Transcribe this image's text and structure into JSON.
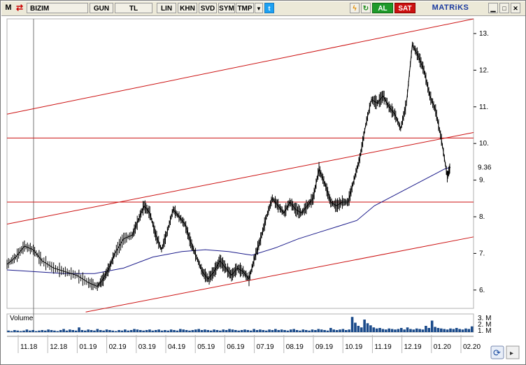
{
  "toolbar": {
    "m_label": "M",
    "symbol": "BIZIM",
    "period": "GUN",
    "currency": "TL",
    "scale": "LIN",
    "buttons": [
      "KHN",
      "SVD",
      "SYM",
      "TMP"
    ],
    "buy": "AL",
    "sell": "SAT",
    "logo": "MATRiKS",
    "colors": {
      "buy": "#1f9a2a",
      "sell": "#cc1111",
      "logo": "#1a3aa0"
    },
    "icons": [
      "app-icon",
      "symbol-arrow-icon",
      "dropdown-arrow-icon",
      "twitter-icon",
      "lightning-icon",
      "refresh-icon",
      "minimize-icon",
      "restore-icon",
      "close-icon",
      "sync-icon"
    ]
  },
  "volume_panel": {
    "title": "Volume",
    "y_ticks": [
      "3. M",
      "2. M",
      "1. M"
    ]
  },
  "chart_data": {
    "type": "line",
    "y_ticks": [
      "13.",
      "12.",
      "11.",
      "10.",
      "9.",
      "8.",
      "7.",
      "6."
    ],
    "y_tick_values": [
      13,
      12,
      11,
      10,
      9,
      8,
      7,
      6
    ],
    "last_price_label": "9.36",
    "x_ticks": [
      "11.18",
      "12.18",
      "01.19",
      "02.19",
      "03.19",
      "04.19",
      "05.19",
      "06.19",
      "07.19",
      "08.19",
      "09.19",
      "10.19",
      "11.19",
      "12.19",
      "01.20",
      "02.20"
    ],
    "ylim": [
      5.5,
      13.4
    ],
    "price_points": [
      [
        0,
        6.7
      ],
      [
        3,
        6.9
      ],
      [
        6,
        7.2
      ],
      [
        9,
        7.1
      ],
      [
        12,
        6.8
      ],
      [
        16,
        6.6
      ],
      [
        20,
        6.5
      ],
      [
        24,
        6.4
      ],
      [
        28,
        6.2
      ],
      [
        31,
        6.1
      ],
      [
        33,
        6.3
      ],
      [
        35,
        6.6
      ],
      [
        37,
        7.0
      ],
      [
        40,
        7.4
      ],
      [
        43,
        7.5
      ],
      [
        45,
        7.9
      ],
      [
        47,
        8.3
      ],
      [
        49,
        8.1
      ],
      [
        51,
        7.5
      ],
      [
        53,
        7.1
      ],
      [
        55,
        7.6
      ],
      [
        57,
        8.2
      ],
      [
        59,
        8.0
      ],
      [
        61,
        7.8
      ],
      [
        63,
        7.3
      ],
      [
        65,
        6.9
      ],
      [
        67,
        6.5
      ],
      [
        69,
        6.3
      ],
      [
        71,
        6.5
      ],
      [
        73,
        6.8
      ],
      [
        75,
        6.6
      ],
      [
        77,
        6.4
      ],
      [
        79,
        6.6
      ],
      [
        81,
        6.5
      ],
      [
        83,
        6.3
      ],
      [
        85,
        6.9
      ],
      [
        87,
        7.4
      ],
      [
        89,
        8.0
      ],
      [
        91,
        8.5
      ],
      [
        93,
        8.3
      ],
      [
        95,
        8.1
      ],
      [
        97,
        8.4
      ],
      [
        99,
        8.2
      ],
      [
        101,
        8.1
      ],
      [
        103,
        8.3
      ],
      [
        105,
        8.5
      ],
      [
        107,
        9.3
      ],
      [
        109,
        8.9
      ],
      [
        111,
        8.4
      ],
      [
        113,
        8.3
      ],
      [
        115,
        8.4
      ],
      [
        117,
        8.4
      ],
      [
        119,
        9.0
      ],
      [
        121,
        9.6
      ],
      [
        123,
        10.5
      ],
      [
        125,
        11.2
      ],
      [
        127,
        11.1
      ],
      [
        129,
        11.3
      ],
      [
        131,
        11.0
      ],
      [
        133,
        10.8
      ],
      [
        135,
        10.4
      ],
      [
        137,
        11.1
      ],
      [
        139,
        12.7
      ],
      [
        141,
        12.4
      ],
      [
        143,
        12.0
      ],
      [
        145,
        11.3
      ],
      [
        147,
        10.9
      ],
      [
        149,
        10.1
      ],
      [
        151,
        9.1
      ],
      [
        152,
        9.36
      ]
    ],
    "ma_points": [
      [
        0,
        6.55
      ],
      [
        10,
        6.5
      ],
      [
        20,
        6.45
      ],
      [
        30,
        6.45
      ],
      [
        40,
        6.6
      ],
      [
        50,
        6.9
      ],
      [
        60,
        7.05
      ],
      [
        68,
        7.1
      ],
      [
        76,
        7.05
      ],
      [
        84,
        6.95
      ],
      [
        92,
        7.15
      ],
      [
        100,
        7.4
      ],
      [
        108,
        7.6
      ],
      [
        114,
        7.75
      ],
      [
        120,
        7.9
      ],
      [
        126,
        8.3
      ],
      [
        132,
        8.55
      ],
      [
        138,
        8.8
      ],
      [
        144,
        9.05
      ],
      [
        150,
        9.3
      ],
      [
        152,
        9.35
      ]
    ],
    "volume_values": [
      0.3,
      0.2,
      0.4,
      0.3,
      0.2,
      0.3,
      0.5,
      0.3,
      0.4,
      0.2,
      0.3,
      0.4,
      0.3,
      0.5,
      0.4,
      0.3,
      0.2,
      0.4,
      0.6,
      0.3,
      0.5,
      0.4,
      0.3,
      0.9,
      0.4,
      0.3,
      0.5,
      0.4,
      0.3,
      0.6,
      0.4,
      0.3,
      0.5,
      0.4,
      0.3,
      0.2,
      0.4,
      0.3,
      0.5,
      0.3,
      0.4,
      0.6,
      0.5,
      0.4,
      0.3,
      0.4,
      0.5,
      0.3,
      0.4,
      0.5,
      0.3,
      0.4,
      0.3,
      0.5,
      0.4,
      0.3,
      0.6,
      0.5,
      0.4,
      0.3,
      0.4,
      0.5,
      0.6,
      0.4,
      0.5,
      0.4,
      0.3,
      0.5,
      0.4,
      0.3,
      0.5,
      0.4,
      0.6,
      0.5,
      0.4,
      0.3,
      0.4,
      0.5,
      0.4,
      0.3,
      0.6,
      0.4,
      0.5,
      0.4,
      0.3,
      0.5,
      0.4,
      0.6,
      0.4,
      0.5,
      0.4,
      0.3,
      0.5,
      0.6,
      0.4,
      0.3,
      0.5,
      0.4,
      0.3,
      0.5,
      0.4,
      0.6,
      0.5,
      0.4,
      0.3,
      0.8,
      0.5,
      0.4,
      0.5,
      0.6,
      0.4,
      0.5,
      2.9,
      1.8,
      1.2,
      0.9,
      2.4,
      1.7,
      1.3,
      0.9,
      0.7,
      0.8,
      0.6,
      0.5,
      0.7,
      0.6,
      0.5,
      0.6,
      0.8,
      0.5,
      0.9,
      0.6,
      0.5,
      0.7,
      0.6,
      0.5,
      1.2,
      0.8,
      2.2,
      1.0,
      0.8,
      0.7,
      0.6,
      0.5,
      0.7,
      0.6,
      0.8,
      0.6,
      0.5,
      0.7,
      0.6,
      1.1
    ],
    "trend_lines": [
      {
        "from": [
          0,
          10.8
        ],
        "to": [
          160,
          13.4
        ]
      },
      {
        "from": [
          0,
          7.8
        ],
        "to": [
          160,
          10.3
        ]
      },
      {
        "from": [
          27,
          5.4
        ],
        "to": [
          160,
          7.45
        ]
      }
    ],
    "horizontal_lines": [
      10.15,
      8.4
    ],
    "colors": {
      "price": "#000000",
      "ma": "#1a1a8a",
      "trend": "#cc1111",
      "volume": "#1a4a8a"
    }
  }
}
